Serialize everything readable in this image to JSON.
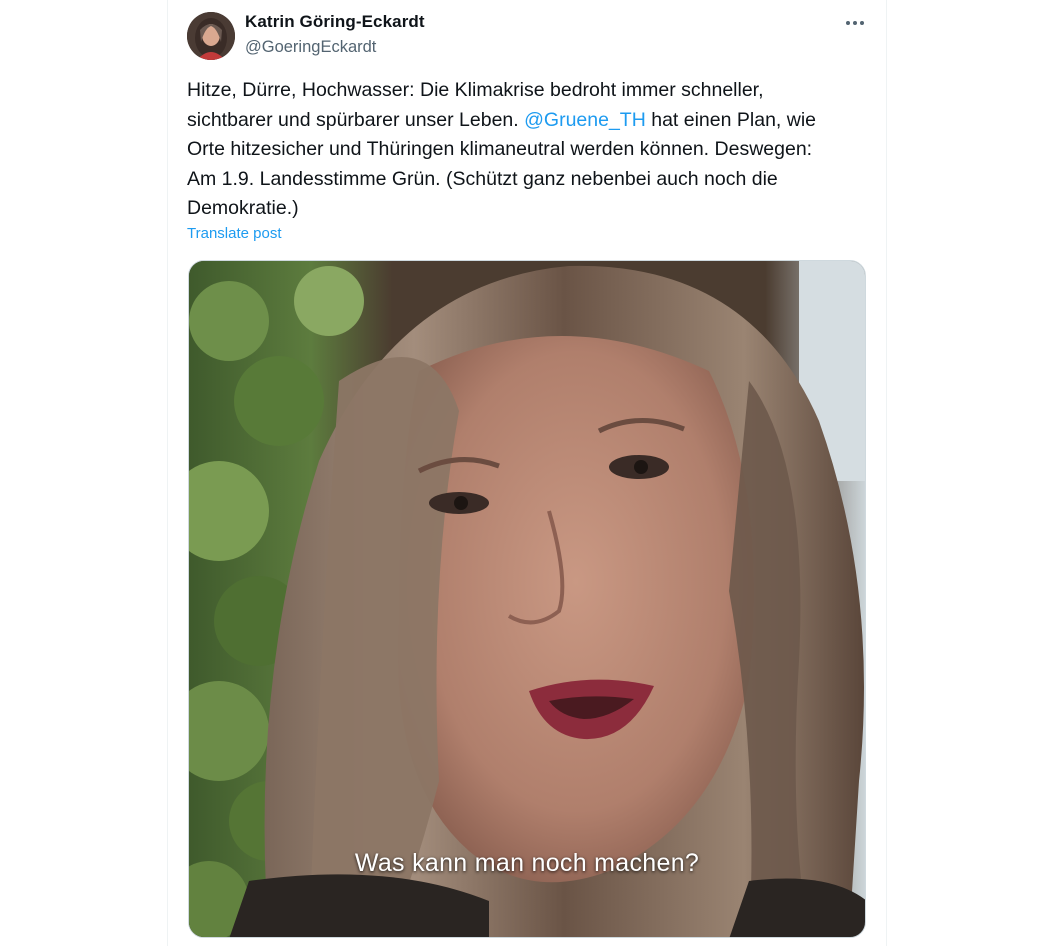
{
  "post": {
    "author_name": "Katrin Göring-Eckardt",
    "author_handle": "@GoeringEckardt",
    "more_icon": "more-horizontal-icon",
    "text_before_mention": "Hitze, Dürre, Hochwasser: Die Klimakrise bedroht immer schneller,\nsichtbarer und spürbarer unser Leben. ",
    "mention": "@Gruene_TH",
    "text_after_mention": " hat einen Plan, wie\nOrte hitzesicher und Thüringen klimaneutral werden können. Deswegen:\nAm 1.9. Landesstimme Grün. (Schützt ganz nebenbei auch noch die\nDemokratie.)",
    "translate_label": "Translate post"
  },
  "video": {
    "subtitle": "Was kann man noch machen?"
  },
  "colors": {
    "text": "#0f1419",
    "secondary": "#536471",
    "link": "#1d9bf0",
    "border": "#eff3f4"
  }
}
